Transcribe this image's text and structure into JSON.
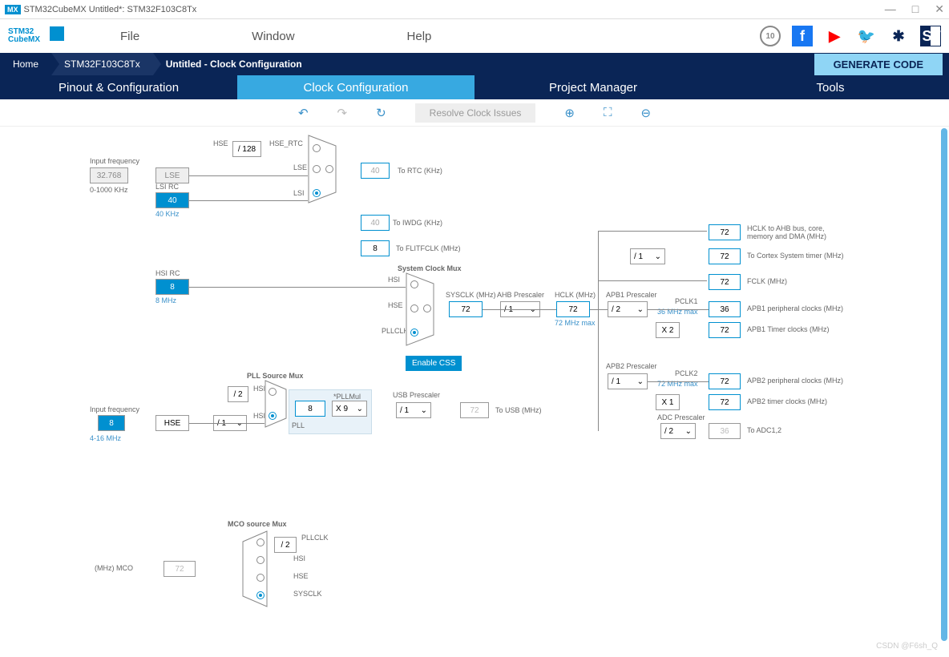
{
  "window": {
    "title": "STM32CubeMX Untitled*: STM32F103C8Tx"
  },
  "logo": {
    "line1": "STM32",
    "line2": "CubeMX"
  },
  "menu": {
    "file": "File",
    "window": "Window",
    "help": "Help"
  },
  "breadcrumb": {
    "home": "Home",
    "chip": "STM32F103C8Tx",
    "page": "Untitled - Clock Configuration",
    "generate": "GENERATE CODE"
  },
  "tabs": {
    "pinout": "Pinout & Configuration",
    "clock": "Clock Configuration",
    "project": "Project Manager",
    "tools": "Tools"
  },
  "toolbar": {
    "resolve": "Resolve Clock Issues"
  },
  "clk": {
    "input_freq_lbl": "Input frequency",
    "lse_val": "32.768",
    "lse_range": "0-1000 KHz",
    "lse_btn": "LSE",
    "lsi_lbl": "LSI RC",
    "lsi_val": "40",
    "lsi_freq": "40 KHz",
    "hsi_lbl": "HSI RC",
    "hsi_val": "8",
    "hsi_freq": "8 MHz",
    "hse_input_val": "8",
    "hse_range": "4-16 MHz",
    "hse_btn": "HSE",
    "hse_div": "/ 128",
    "hse_rtc_lbl": "HSE_RTC",
    "hse_sig": "HSE",
    "lse_sig": "LSE",
    "lsi_sig": "LSI",
    "hsi_sig": "HSI",
    "rtc_val": "40",
    "rtc_lbl": "To RTC (KHz)",
    "iwdg_val": "40",
    "iwdg_lbl": "To IWDG (KHz)",
    "flitf_val": "8",
    "flitf_lbl": "To FLITFCLK (MHz)",
    "sysmux_lbl": "System Clock Mux",
    "pllmux_lbl": "PLL Source Mux",
    "pll_div": "/ 2",
    "pll_val": "8",
    "pll_mul_lbl": "*PLLMul",
    "pll_mul": "X 9",
    "pll_name": "PLL",
    "pllclk": "PLLCLK",
    "css": "Enable CSS",
    "sysclk_lbl": "SYSCLK (MHz)",
    "sysclk_val": "72",
    "ahb_lbl": "AHB Prescaler",
    "ahb_div": "/ 1",
    "hclk_lbl": "HCLK (MHz)",
    "hclk_val": "72",
    "hclk_max": "72 MHz max",
    "usb_lbl": "USB Prescaler",
    "usb_div": "/ 1",
    "usb_val": "72",
    "usb_to": "To USB (MHz)",
    "hse_div_hclk": "/ 1",
    "out_ahb_val": "72",
    "out_ahb_lbl": "HCLK to AHB bus, core, memory and DMA (MHz)",
    "out_cortex_val": "72",
    "out_cortex_lbl": "To Cortex System timer (MHz)",
    "out_fclk_val": "72",
    "out_fclk_lbl": "FCLK (MHz)",
    "apb1_lbl": "APB1 Prescaler",
    "apb1_div": "/ 2",
    "apb1_pclk": "PCLK1",
    "apb1_max": "36 MHz max",
    "apb1_per_val": "36",
    "apb1_per_lbl": "APB1 peripheral clocks (MHz)",
    "apb1_mul": "X 2",
    "apb1_tim_val": "72",
    "apb1_tim_lbl": "APB1 Timer clocks (MHz)",
    "apb2_lbl": "APB2 Prescaler",
    "apb2_div": "/ 1",
    "apb2_pclk": "PCLK2",
    "apb2_max": "72 MHz max",
    "apb2_per_val": "72",
    "apb2_per_lbl": "APB2 peripheral clocks (MHz)",
    "apb2_mul": "X 1",
    "apb2_tim_val": "72",
    "apb2_tim_lbl": "APB2 timer clocks (MHz)",
    "adc_lbl": "ADC Prescaler",
    "adc_div": "/ 2",
    "adc_val": "36",
    "adc_to": "To ADC1,2",
    "mco_lbl": "MCO source Mux",
    "mco_div": "/ 2",
    "mco_out_lbl": "(MHz) MCO",
    "mco_val": "72",
    "mco_pllclk": "PLLCLK",
    "mco_hsi": "HSI",
    "mco_hse": "HSE",
    "mco_sysclk": "SYSCLK",
    "prescaler_1": "/ 1"
  },
  "watermark": "CSDN @F6sh_Q"
}
